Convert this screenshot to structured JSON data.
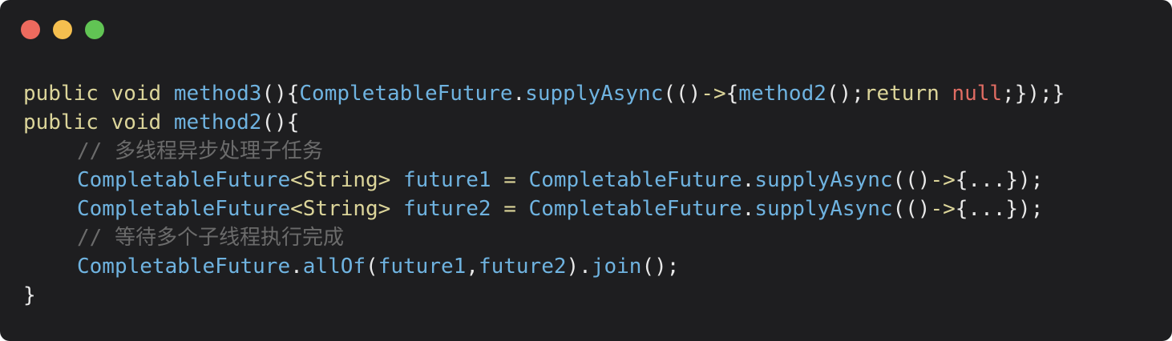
{
  "window": {
    "controls": [
      {
        "name": "close",
        "color": "#ed6a5e"
      },
      {
        "name": "minimize",
        "color": "#f5bf4f"
      },
      {
        "name": "zoom",
        "color": "#61c454"
      }
    ]
  },
  "colors": {
    "background": "#1e1e20",
    "keyword": "#dcd59a",
    "method": "#6fb3e0",
    "type": "#dcd59a",
    "operator": "#dcd59a",
    "null": "#e06c63",
    "comment": "#6b6b6b",
    "plain": "#e8e8e8",
    "punct": "#e8e8e8"
  },
  "code": {
    "lines": [
      {
        "indent": false,
        "tokens": [
          {
            "t": "public",
            "k": "keyword"
          },
          {
            "t": " ",
            "k": "plain"
          },
          {
            "t": "void",
            "k": "keyword"
          },
          {
            "t": " ",
            "k": "plain"
          },
          {
            "t": "method3",
            "k": "method"
          },
          {
            "t": "()",
            "k": "punct"
          },
          {
            "t": "{",
            "k": "punct"
          },
          {
            "t": "CompletableFuture",
            "k": "method"
          },
          {
            "t": ".",
            "k": "punct"
          },
          {
            "t": "supplyAsync",
            "k": "method"
          },
          {
            "t": "(()",
            "k": "punct"
          },
          {
            "t": "->",
            "k": "operator"
          },
          {
            "t": "{",
            "k": "punct"
          },
          {
            "t": "method2",
            "k": "method"
          },
          {
            "t": "();",
            "k": "punct"
          },
          {
            "t": "return",
            "k": "keyword"
          },
          {
            "t": " ",
            "k": "plain"
          },
          {
            "t": "null",
            "k": "null"
          },
          {
            "t": ";});}",
            "k": "punct"
          }
        ]
      },
      {
        "indent": false,
        "tokens": [
          {
            "t": "public",
            "k": "keyword"
          },
          {
            "t": " ",
            "k": "plain"
          },
          {
            "t": "void",
            "k": "keyword"
          },
          {
            "t": " ",
            "k": "plain"
          },
          {
            "t": "method2",
            "k": "method"
          },
          {
            "t": "(){",
            "k": "punct"
          }
        ]
      },
      {
        "indent": true,
        "tokens": [
          {
            "t": "// 多线程异步处理子任务",
            "k": "comment"
          }
        ]
      },
      {
        "indent": true,
        "tokens": [
          {
            "t": "CompletableFuture",
            "k": "method"
          },
          {
            "t": "<String>",
            "k": "type"
          },
          {
            "t": " ",
            "k": "plain"
          },
          {
            "t": "future1",
            "k": "method"
          },
          {
            "t": " ",
            "k": "plain"
          },
          {
            "t": "=",
            "k": "operator"
          },
          {
            "t": " ",
            "k": "plain"
          },
          {
            "t": "CompletableFuture",
            "k": "method"
          },
          {
            "t": ".",
            "k": "punct"
          },
          {
            "t": "supplyAsync",
            "k": "method"
          },
          {
            "t": "(()",
            "k": "punct"
          },
          {
            "t": "->",
            "k": "operator"
          },
          {
            "t": "{...});",
            "k": "punct"
          }
        ]
      },
      {
        "indent": true,
        "tokens": [
          {
            "t": "CompletableFuture",
            "k": "method"
          },
          {
            "t": "<String>",
            "k": "type"
          },
          {
            "t": " ",
            "k": "plain"
          },
          {
            "t": "future2",
            "k": "method"
          },
          {
            "t": " ",
            "k": "plain"
          },
          {
            "t": "=",
            "k": "operator"
          },
          {
            "t": " ",
            "k": "plain"
          },
          {
            "t": "CompletableFuture",
            "k": "method"
          },
          {
            "t": ".",
            "k": "punct"
          },
          {
            "t": "supplyAsync",
            "k": "method"
          },
          {
            "t": "(()",
            "k": "punct"
          },
          {
            "t": "->",
            "k": "operator"
          },
          {
            "t": "{...});",
            "k": "punct"
          }
        ]
      },
      {
        "indent": true,
        "tokens": [
          {
            "t": "// 等待多个子线程执行完成",
            "k": "comment"
          }
        ]
      },
      {
        "indent": true,
        "tokens": [
          {
            "t": "CompletableFuture",
            "k": "method"
          },
          {
            "t": ".",
            "k": "punct"
          },
          {
            "t": "allOf",
            "k": "method"
          },
          {
            "t": "(",
            "k": "punct"
          },
          {
            "t": "future1",
            "k": "method"
          },
          {
            "t": ",",
            "k": "punct"
          },
          {
            "t": "future2",
            "k": "method"
          },
          {
            "t": ").",
            "k": "punct"
          },
          {
            "t": "join",
            "k": "method"
          },
          {
            "t": "();",
            "k": "punct"
          }
        ]
      },
      {
        "indent": false,
        "tokens": [
          {
            "t": "}",
            "k": "punct"
          }
        ]
      }
    ]
  }
}
